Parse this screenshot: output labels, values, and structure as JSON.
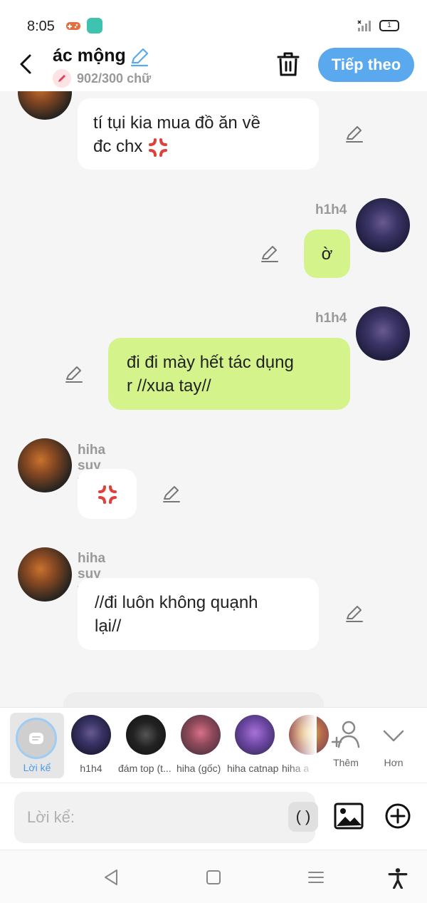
{
  "status": {
    "time": "8:05",
    "battery": "1"
  },
  "header": {
    "title": "ác mộng",
    "wordcount": "902/300 chữ",
    "next_label": "Tiếp theo"
  },
  "messages": [
    {
      "lines": [
        "tí tụi kia mua đồ ăn về",
        "đc chx"
      ]
    },
    {
      "sender": "h1h4",
      "text": "ờ"
    },
    {
      "sender": "h1h4",
      "lines": [
        "đi đi mày hết tác dụng",
        "r //xua tay//"
      ]
    },
    {
      "sender": "hiha suy vong"
    },
    {
      "sender": "hiha suy vong",
      "lines": [
        "//đi luôn không quạnh",
        "lại//"
      ]
    }
  ],
  "cast": [
    {
      "label": "Lời kể"
    },
    {
      "label": "h1h4"
    },
    {
      "label": "đám top (t..."
    },
    {
      "label": "hiha (gốc)"
    },
    {
      "label": "hiha catnap"
    },
    {
      "label": "hiha a"
    }
  ],
  "cast_actions": {
    "more_label": "Thêm",
    "expand_label": "Hơn"
  },
  "input": {
    "placeholder": "Lời kể:",
    "paren_label": "( )"
  },
  "colors": {
    "accent": "#5aa9ef",
    "green_bubble": "#d4f38b",
    "anger": "#e0403a"
  }
}
